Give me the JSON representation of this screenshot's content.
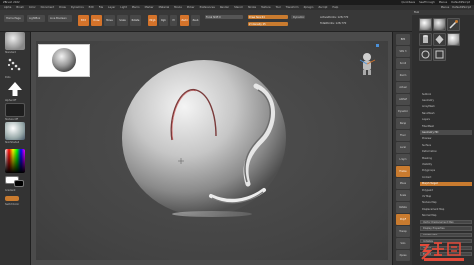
{
  "titlebar": {
    "title": "ZBrush 2022",
    "buttons": [
      "QuickSave",
      "SeeThrough",
      "Menus",
      "DefaultZScript"
    ]
  },
  "menubar": {
    "items": [
      "Alpha",
      "Brush",
      "Color",
      "Document",
      "Draw",
      "Dynamics",
      "Edit",
      "File",
      "Layer",
      "Light",
      "Macro",
      "Marker",
      "Material",
      "Movie",
      "Picker",
      "Preferences",
      "Render",
      "Stencil",
      "Stroke",
      "Texture",
      "Tool",
      "Transform",
      "Zplugin",
      "Zscript",
      "Help"
    ],
    "right_items": [
      "Menus",
      "DefaultZScript"
    ]
  },
  "topbar": {
    "home_page": "Home Page",
    "lightbox": "LightBox",
    "live_boolean": "Live Boolean",
    "edit": "Edit",
    "draw": "Draw",
    "move": "Move",
    "scale": "Scale",
    "rotate": "Rotate",
    "mrgb": "Mrgb",
    "rgb": "Rgb",
    "m": "M",
    "zadd": "Zadd",
    "zsub": "Zsub",
    "focal_shift": "Focal Shift 0",
    "draw_size": "Draw Size 64",
    "z_intensity": "Z Intensity 25",
    "dynamic": "Dynamic",
    "active_points": "ActivePoints: 128,770",
    "total_points": "TotalPoints: 128,770"
  },
  "leftpanel": {
    "standard_label": "Standard",
    "dots_label": "Dots",
    "alpha_label": "Alpha Off",
    "texture_label": "Texture Off",
    "material_label": "SkinShade4",
    "gradient_label": "Gradient",
    "switch_color_label": "SwitchColor"
  },
  "canvas": {
    "thumb_alt": "Sphere preview"
  },
  "rightstrip": {
    "buttons": [
      "BPR",
      "SPix 3",
      "Scroll",
      "Zoom",
      "Actual",
      "AAHalf",
      "Dynamic",
      "Persp",
      "Floor",
      "Local",
      "L.Sym",
      "Frame",
      "Move",
      "Scale",
      "Rotate",
      "PolyF",
      "Transp",
      "Solo",
      "Xpose"
    ]
  },
  "tray": {
    "header": "Tool",
    "subtools": [
      "Sphere3D",
      "PolySphere",
      "SimpleBrush",
      "Cylinder3D",
      "PolyMesh3D",
      "Sphere3D_1"
    ],
    "menu_items": [
      "Subtool",
      "Geometry",
      "ArrayMesh",
      "NanoMesh",
      "Layers",
      "FiberMesh",
      "Geometry HD",
      "Preview",
      "Surface",
      "Deformation",
      "Masking",
      "Visibility",
      "Polygroups",
      "Contact",
      "Morph Target",
      "Polypaint",
      "UV Map",
      "Texture Map",
      "Displacement Map",
      "Normal Map",
      "Vector Displacement Map",
      "Display Properties",
      "Unified Skin",
      "Initialize",
      "Import",
      "Export"
    ],
    "selected_item": "Geometry HD",
    "highlight_item": "Morph Target"
  },
  "colors": {
    "accent": "#d5732a",
    "background": "#4b4b4b",
    "panel": "#333333"
  }
}
